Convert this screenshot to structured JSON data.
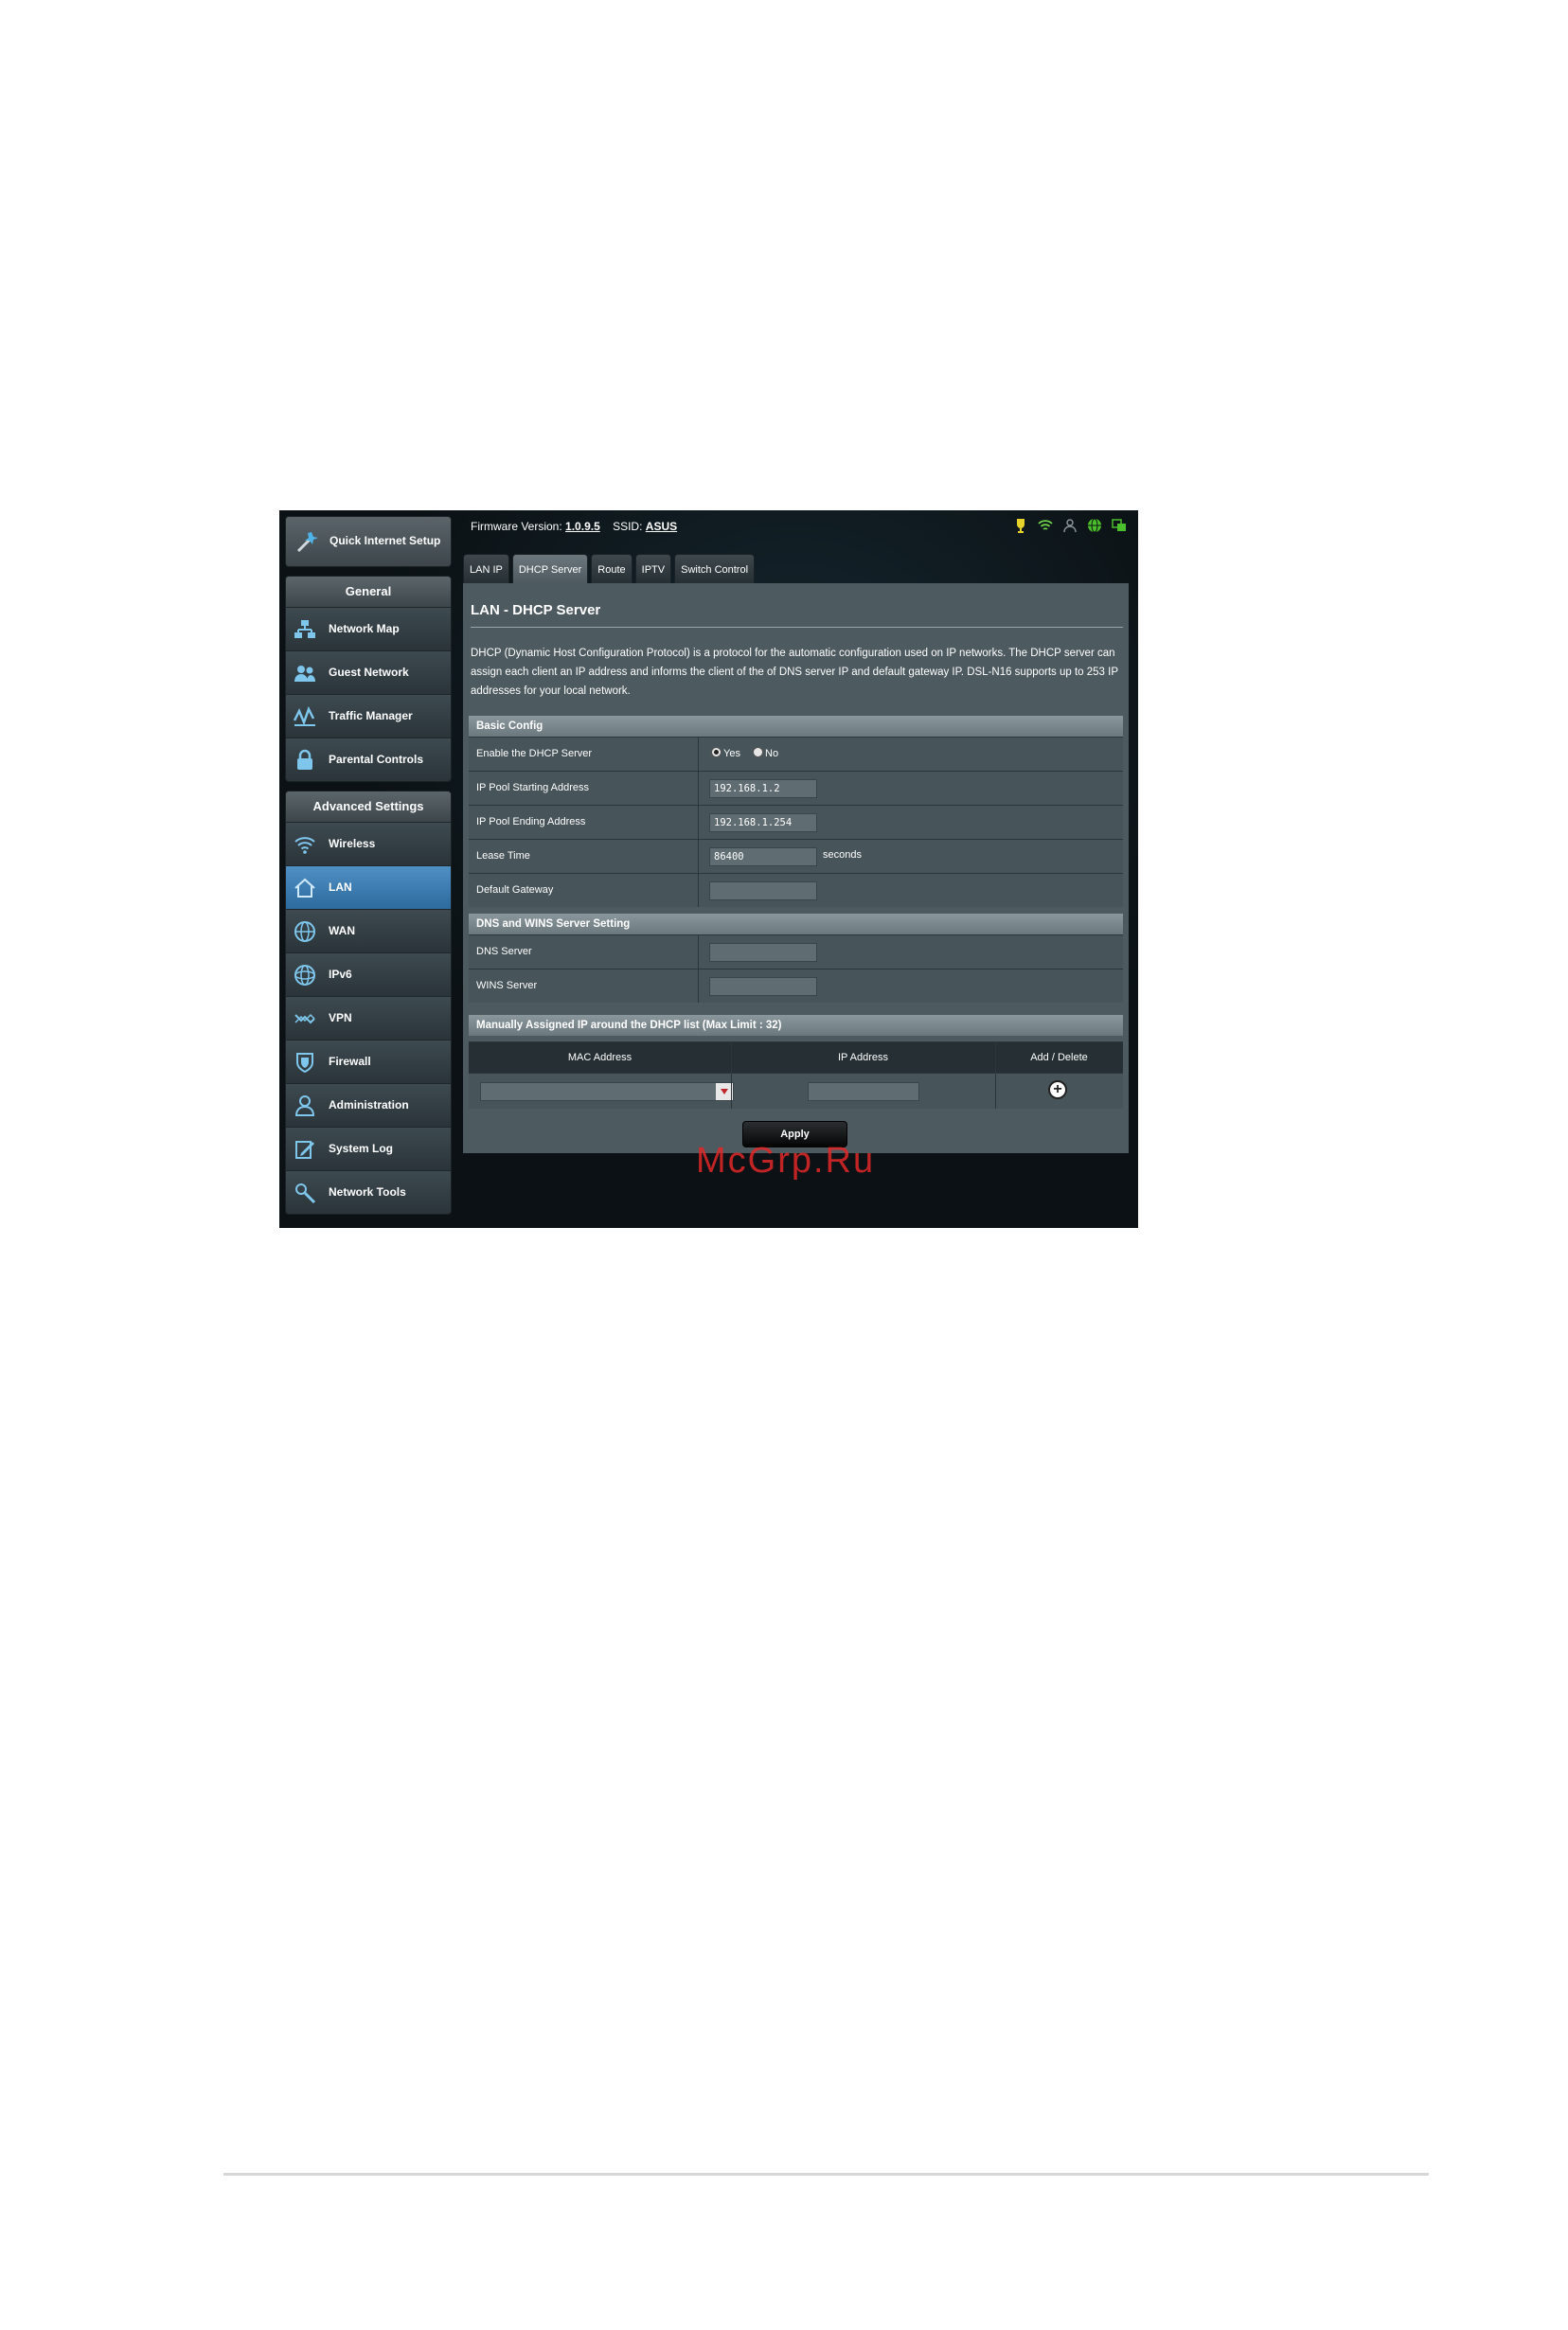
{
  "topbar": {
    "firmware_label": "Firmware Version:",
    "firmware_value": "1.0.9.5",
    "ssid_label": "SSID:",
    "ssid_value": "ASUS"
  },
  "sidebar": {
    "quick_setup": "Quick Internet Setup",
    "general_title": "General",
    "general_items": [
      {
        "label": "Network Map",
        "icon": "network-map-icon"
      },
      {
        "label": "Guest Network",
        "icon": "guest-network-icon"
      },
      {
        "label": "Traffic Manager",
        "icon": "traffic-manager-icon"
      },
      {
        "label": "Parental Controls",
        "icon": "lock-icon"
      }
    ],
    "advanced_title": "Advanced Settings",
    "advanced_items": [
      {
        "label": "Wireless",
        "icon": "wifi-icon"
      },
      {
        "label": "LAN",
        "icon": "home-icon",
        "active": true
      },
      {
        "label": "WAN",
        "icon": "globe-icon"
      },
      {
        "label": "IPv6",
        "icon": "ipv6-globe-icon"
      },
      {
        "label": "VPN",
        "icon": "vpn-icon"
      },
      {
        "label": "Firewall",
        "icon": "shield-icon"
      },
      {
        "label": "Administration",
        "icon": "admin-user-icon"
      },
      {
        "label": "System Log",
        "icon": "system-log-icon"
      },
      {
        "label": "Network Tools",
        "icon": "tools-icon"
      }
    ]
  },
  "tabs": [
    "LAN IP",
    "DHCP Server",
    "Route",
    "IPTV",
    "Switch Control"
  ],
  "page": {
    "title": "LAN - DHCP Server",
    "description": "DHCP (Dynamic Host Configuration Protocol) is a protocol for the automatic configuration used on IP networks. The DHCP server can assign each client an IP address and informs the client of the of DNS server IP and default gateway IP. DSL-N16 supports up to 253 IP addresses for your local network."
  },
  "basic_config": {
    "title": "Basic Config",
    "enable_label": "Enable the DHCP Server",
    "yes": "Yes",
    "no": "No",
    "enabled": "Yes",
    "start_label": "IP Pool Starting Address",
    "start_value": "192.168.1.2",
    "end_label": "IP Pool Ending Address",
    "end_value": "192.168.1.254",
    "lease_label": "Lease Time",
    "lease_value": "86400",
    "lease_unit": "seconds",
    "gateway_label": "Default Gateway",
    "gateway_value": ""
  },
  "dns_wins": {
    "title": "DNS and WINS Server Setting",
    "dns_label": "DNS Server",
    "dns_value": "",
    "wins_label": "WINS Server",
    "wins_value": ""
  },
  "manual_ip": {
    "title": "Manually Assigned IP around the DHCP list (Max Limit : 32)",
    "col_mac": "MAC Address",
    "col_ip": "IP Address",
    "col_action": "Add / Delete"
  },
  "apply_label": "Apply",
  "watermark": "McGrp.Ru",
  "colors": {
    "accent_active": "#3d7fb3",
    "panel": "#4d5a5f",
    "background": "#0b1114"
  }
}
